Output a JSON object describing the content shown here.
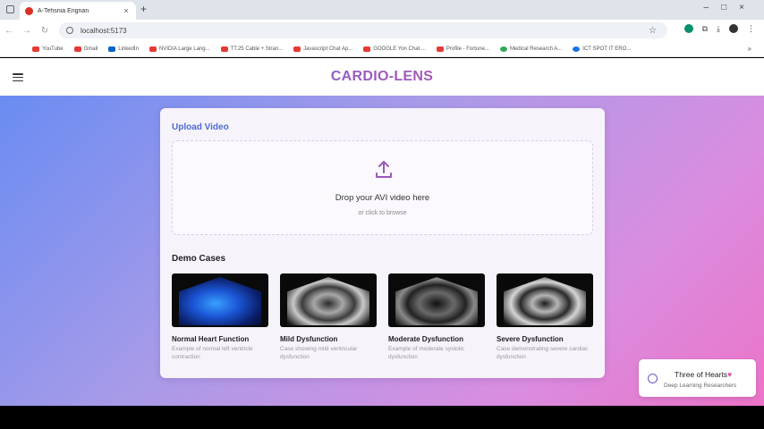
{
  "browser": {
    "tab_title": "A-Tehsnia Engnan",
    "url": "localhost:5173",
    "bookmarks": [
      {
        "label": "YouTube",
        "icon": "youtube-icon"
      },
      {
        "label": "Gmail",
        "icon": "gmail-icon"
      },
      {
        "label": "LinkedIn",
        "icon": "linkedin-icon"
      },
      {
        "label": "NVIDIA Large Lang...",
        "icon": "youtube-icon"
      },
      {
        "label": "TT.25 Cable + Stran...",
        "icon": "youtube-icon"
      },
      {
        "label": "Javascript Chat Ap...",
        "icon": "youtube-icon"
      },
      {
        "label": "GOOGLE Yon Chat ...",
        "icon": "youtube-icon"
      },
      {
        "label": "Profile - Fortune...",
        "icon": "profile-icon"
      },
      {
        "label": "Medical Research A...",
        "icon": "medical-icon"
      },
      {
        "label": "ICT SPOT IT ERO...",
        "icon": "site-icon"
      }
    ]
  },
  "app": {
    "brand": "CARDIO-LENS",
    "upload": {
      "section_title": "Upload Video",
      "drop_title": "Drop your AVI video here",
      "drop_sub": "or click to browse"
    },
    "demo_title": "Demo Cases",
    "demos": [
      {
        "name": "Normal Heart Function",
        "desc": "Example of normal left ventricle contraction"
      },
      {
        "name": "Mild Dysfunction",
        "desc": "Case showing mild ventricular dysfunction"
      },
      {
        "name": "Moderate Dysfunction",
        "desc": "Example of moderate systolic dysfunction"
      },
      {
        "name": "Severe Dysfunction",
        "desc": "Case demonstrating severe cardiac dysfunction"
      }
    ],
    "team": {
      "name": "Three of Hearts",
      "heart": "♥",
      "role": "Deep Learning Researchers"
    }
  },
  "colors": {
    "brand_start": "#4f6edb",
    "brand_end": "#e8459e",
    "upload_icon": "#9b59b6",
    "section_title": "#4b6cd5"
  }
}
